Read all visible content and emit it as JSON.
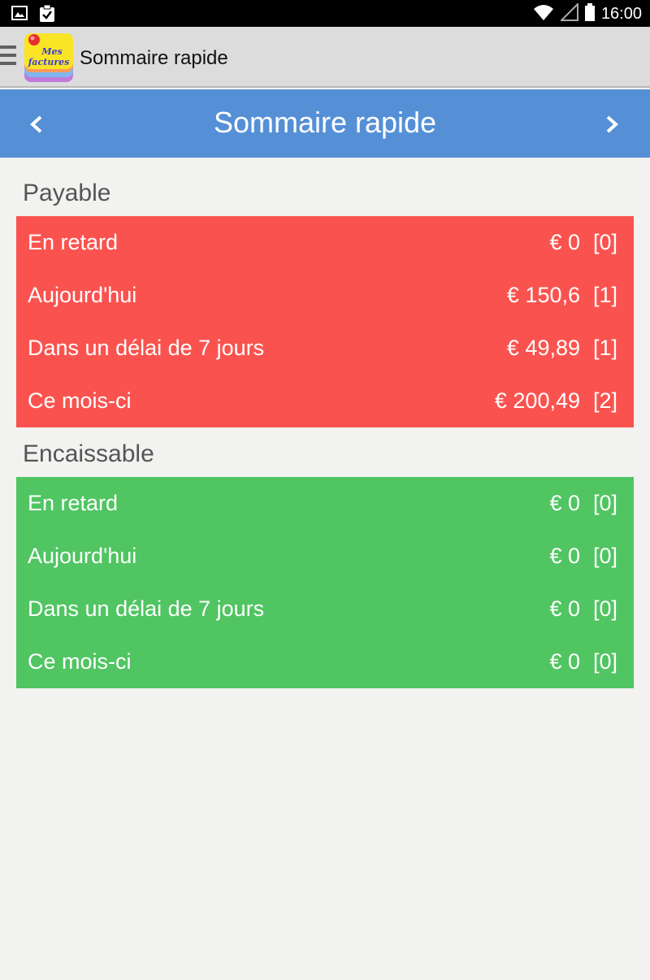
{
  "status_bar": {
    "time": "16:00",
    "icons": [
      "image-icon",
      "clipboard-check-icon",
      "wifi-icon",
      "signal-icon",
      "battery-icon"
    ]
  },
  "action_bar": {
    "logo_text_line1": "Mes",
    "logo_text_line2": "factures",
    "title": "Sommaire rapide"
  },
  "nav": {
    "title": "Sommaire rapide",
    "prev_icon": "chevron-left-icon",
    "next_icon": "chevron-right-icon"
  },
  "payable": {
    "title": "Payable",
    "color": "#fa534f",
    "rows": [
      {
        "label": "En retard",
        "amount": "€ 0",
        "count": "[0]"
      },
      {
        "label": "Aujourd'hui",
        "amount": "€ 150,6",
        "count": "[1]"
      },
      {
        "label": "Dans un délai de 7 jours",
        "amount": "€ 49,89",
        "count": "[1]"
      },
      {
        "label": "Ce mois-ci",
        "amount": "€ 200,49",
        "count": "[2]"
      }
    ]
  },
  "receivable": {
    "title": "Encaissable",
    "color": "#50c562",
    "rows": [
      {
        "label": "En retard",
        "amount": "€ 0",
        "count": "[0]"
      },
      {
        "label": "Aujourd'hui",
        "amount": "€ 0",
        "count": "[0]"
      },
      {
        "label": "Dans un délai de 7 jours",
        "amount": "€ 0",
        "count": "[0]"
      },
      {
        "label": "Ce mois-ci",
        "amount": "€ 0",
        "count": "[0]"
      }
    ]
  },
  "colors": {
    "nav_blue": "#5590d6",
    "background": "#f2f2f0"
  }
}
